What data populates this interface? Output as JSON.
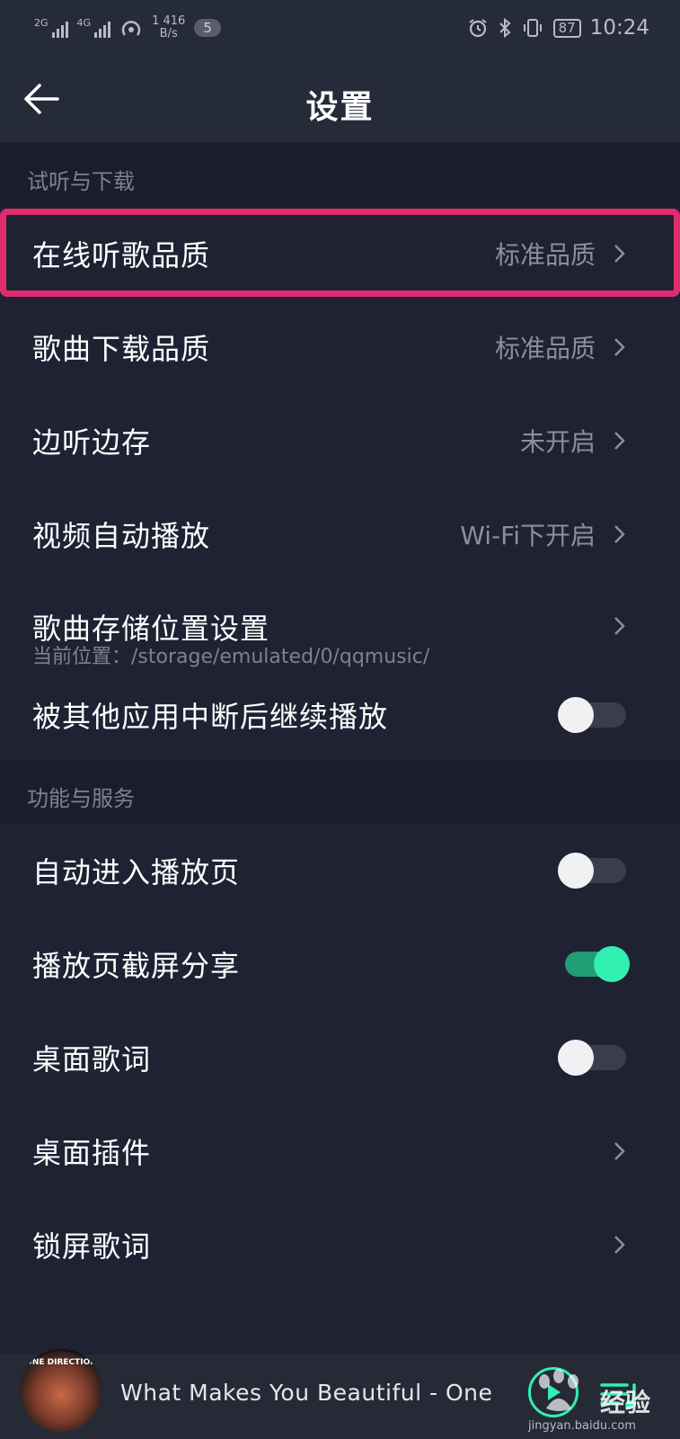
{
  "status_bar": {
    "signal1_label": "2G",
    "signal2_label": "4G",
    "speed_value": "416",
    "speed_unit": "B/s",
    "speed_prefix": "1",
    "notification_count": "5",
    "battery": "87",
    "time": "10:24"
  },
  "header": {
    "title": "设置"
  },
  "sections": [
    {
      "title": "试听与下载",
      "rows": [
        {
          "label": "在线听歌品质",
          "value": "标准品质"
        },
        {
          "label": "歌曲下载品质",
          "value": "标准品质"
        },
        {
          "label": "边听边存",
          "value": "未开启"
        },
        {
          "label": "视频自动播放",
          "value": "Wi-Fi下开启"
        },
        {
          "label": "歌曲存储位置设置",
          "sub": "当前位置：/storage/emulated/0/qqmusic/"
        },
        {
          "label": "被其他应用中断后继续播放",
          "toggle_on": false
        }
      ]
    },
    {
      "title": "功能与服务",
      "rows": [
        {
          "label": "自动进入播放页",
          "toggle_on": false
        },
        {
          "label": "播放页截屏分享",
          "toggle_on": true
        },
        {
          "label": "桌面歌词",
          "toggle_on": false
        },
        {
          "label": "桌面插件"
        },
        {
          "label": "锁屏歌词"
        }
      ]
    }
  ],
  "player": {
    "song": "What Makes You Beautiful - One Direction",
    "album_text": "ONE DIRECTION"
  },
  "watermark": {
    "text": "经验",
    "url": "jingyan.baidu.com"
  },
  "colors": {
    "accent": "#31f0b2",
    "highlight": "#e02c6f",
    "background": "#1b1f2e"
  }
}
